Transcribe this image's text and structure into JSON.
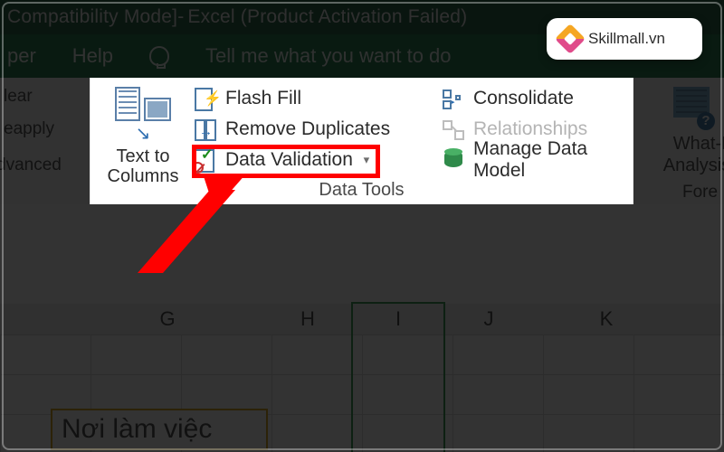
{
  "titlebar": {
    "mode": "Compatibility Mode]",
    "separator": "  -  ",
    "app": "Excel (Product Activation Failed)"
  },
  "tabstrip": {
    "tab_left": "per",
    "tab_help": "Help",
    "tell_me": "Tell me what you want to do"
  },
  "ribbon": {
    "sort_filter": {
      "clear": "lear",
      "reapply": "eapply",
      "advanced": "dvanced"
    },
    "data_tools": {
      "text_to_columns_line1": "Text to",
      "text_to_columns_line2": "Columns",
      "flash_fill": "Flash Fill",
      "remove_duplicates": "Remove Duplicates",
      "data_validation": "Data Validation",
      "consolidate": "Consolidate",
      "relationships": "Relationships",
      "manage_data_model": "Manage Data Model",
      "group_label": "Data Tools"
    },
    "forecast": {
      "line1": "What-If",
      "line2": "Analysis",
      "group_label": "Fore"
    }
  },
  "sheet": {
    "columns": {
      "g": "G",
      "h": "H",
      "i": "I",
      "j": "J",
      "k": "K"
    },
    "cell_text": "Nơi làm việc"
  },
  "brand": {
    "text": "Skillmall.vn"
  }
}
